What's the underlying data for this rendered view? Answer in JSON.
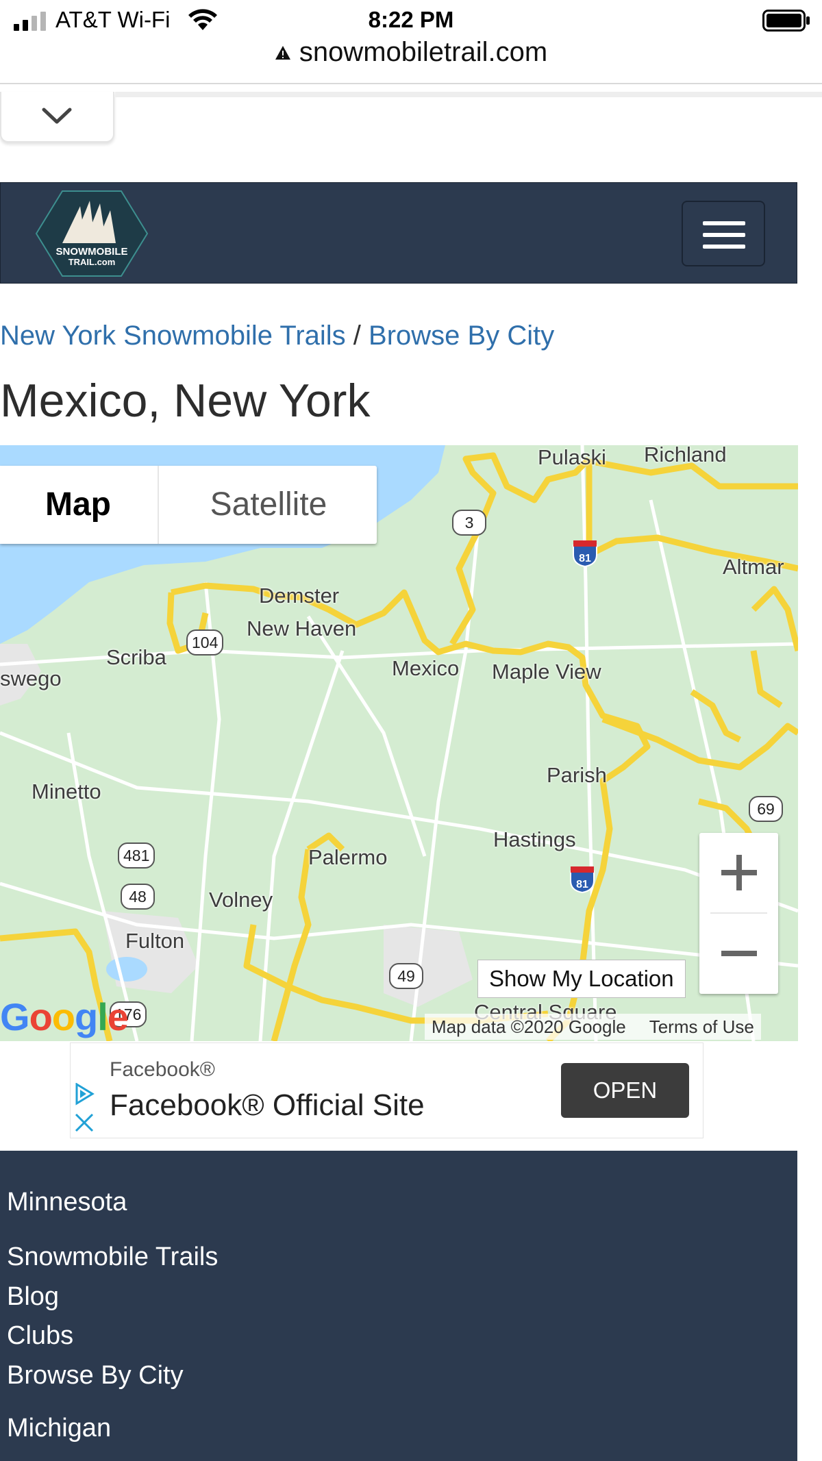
{
  "status_bar": {
    "carrier": "AT&T Wi-Fi",
    "time": "8:22 PM"
  },
  "browser": {
    "url": "snowmobiletrail.com"
  },
  "site": {
    "logo_text_line1": "SNOWMOBILE",
    "logo_text_line2": "TRAIL.com"
  },
  "breadcrumb": {
    "parent_label": "New York Snowmobile Trails",
    "separator": "/",
    "current_label": "Browse By City"
  },
  "page_title": "Mexico, New York",
  "map": {
    "type_map_label": "Map",
    "type_satellite_label": "Satellite",
    "zoom_in_label": "+",
    "zoom_out_label": "−",
    "show_location_label": "Show My Location",
    "attribution": "Map data ©2020 Google",
    "terms_label": "Terms of Use",
    "google_logo": "Google",
    "places": {
      "pulaski": "Pulaski",
      "richland": "Richland",
      "altmar": "Altmar",
      "demster": "Demster",
      "new_haven": "New Haven",
      "scriba": "Scriba",
      "oswego": "swego",
      "mexico": "Mexico",
      "maple_view": "Maple View",
      "parish": "Parish",
      "minetto": "Minetto",
      "hastings": "Hastings",
      "palermo": "Palermo",
      "volney": "Volney",
      "fulton": "Fulton",
      "central_square": "Central Square"
    },
    "route_shields": {
      "r3": "3",
      "r104": "104",
      "r481": "481",
      "r48": "48",
      "r49": "49",
      "r69": "69",
      "r176": "176"
    },
    "interstate_number": "81"
  },
  "ad": {
    "sponsor": "Facebook®",
    "headline": "Facebook® Official Site",
    "button_label": "OPEN"
  },
  "footer": {
    "state_1": "Minnesota",
    "links": [
      "Snowmobile Trails",
      "Blog",
      "Clubs",
      "Browse By City"
    ],
    "state_2": "Michigan"
  },
  "colors": {
    "header_bg": "#2c3a4f",
    "link": "#2f6fab",
    "trail": "#f5d33a",
    "map_land": "#d4ecd1",
    "water": "#aadaff"
  }
}
